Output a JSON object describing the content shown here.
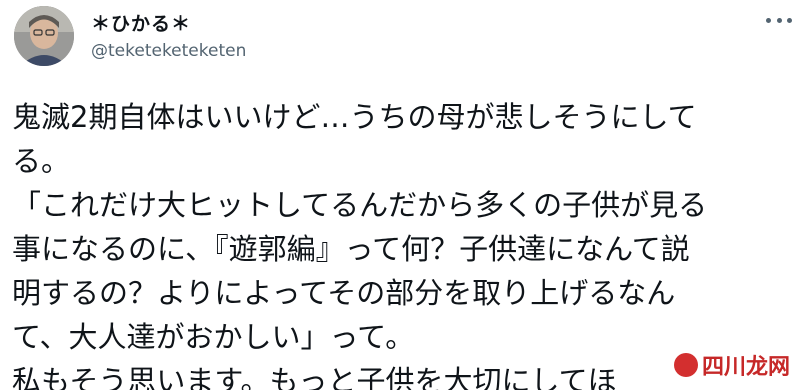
{
  "user": {
    "display_name": "＊ひかる＊",
    "handle": "@teketeketeketen",
    "avatar": "profile-photo"
  },
  "tweet": {
    "lines": [
      "鬼滅2期自体はいいけど…うちの母が悲しそうにして",
      "る。",
      "「これだけ大ヒットしてるんだから多くの子供が見る",
      "事になるのに、『遊郭編』って何？子供達になんて説",
      "明するの？よりによってその部分を取り上げるなん",
      "て、大人達がおかしい」って。",
      "私もそう思います。もっと子供を大切にしてほ"
    ]
  },
  "icons": {
    "more": "more-horizontal-icon"
  },
  "watermark": {
    "text": "四川龙网"
  },
  "colors": {
    "text": "#0f1419",
    "secondary": "#536471",
    "watermark": "#c62828"
  }
}
